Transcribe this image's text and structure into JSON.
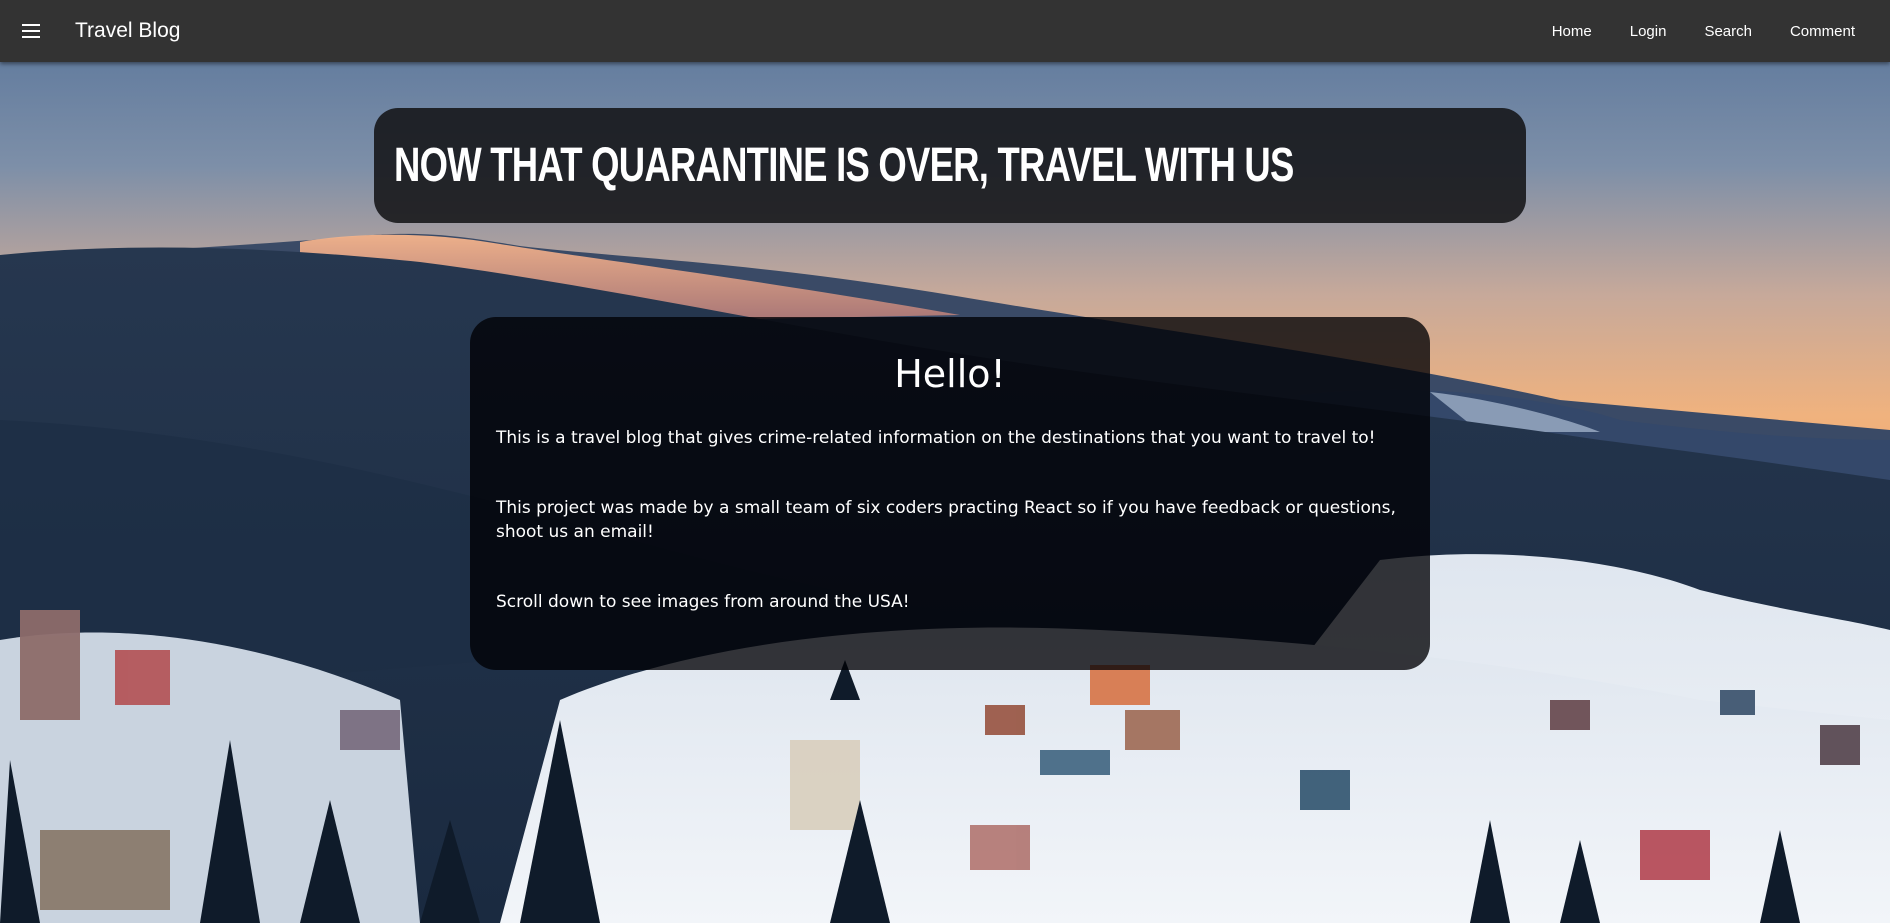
{
  "app_bar": {
    "menu_icon": "menu-icon",
    "brand": "Travel Blog",
    "nav": [
      {
        "label": "Home"
      },
      {
        "label": "Login"
      },
      {
        "label": "Search"
      },
      {
        "label": "Comment"
      }
    ],
    "background_color": "#333333"
  },
  "hero": {
    "headline": "Now that quarantine is over, travel with us",
    "background_image": "snowy mountain village at sunset"
  },
  "intro": {
    "title": "Hello!",
    "paragraphs": [
      "This is a travel blog that gives crime-related information on the destinations that you want to travel to!",
      "This project was made by a small team of six coders practing React so if you have feedback or questions, shoot us an email!",
      "Scroll down to see images from around the USA!"
    ]
  }
}
